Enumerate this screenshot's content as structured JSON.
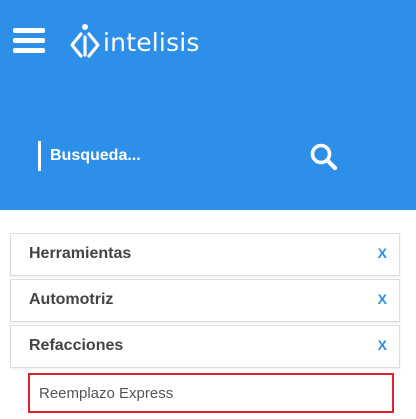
{
  "header": {
    "menu_icon": "hamburger-menu-icon",
    "logo_text": "intelisis",
    "logo_icon": "intelisis-diamond-logo-icon",
    "background_color": "#2e8fe8"
  },
  "search": {
    "placeholder": "Busqueda...",
    "value": "",
    "button_icon": "magnifier-search-icon"
  },
  "categories": [
    {
      "label": "Herramientas",
      "remove_label": "X"
    },
    {
      "label": "Automotriz",
      "remove_label": "X"
    },
    {
      "label": "Refacciones",
      "remove_label": "X"
    }
  ],
  "subcategory": {
    "label": "Reemplazo Express",
    "highlight_color": "#e0202e"
  },
  "colors": {
    "accent": "#2e8fe8",
    "text": "#444444"
  }
}
